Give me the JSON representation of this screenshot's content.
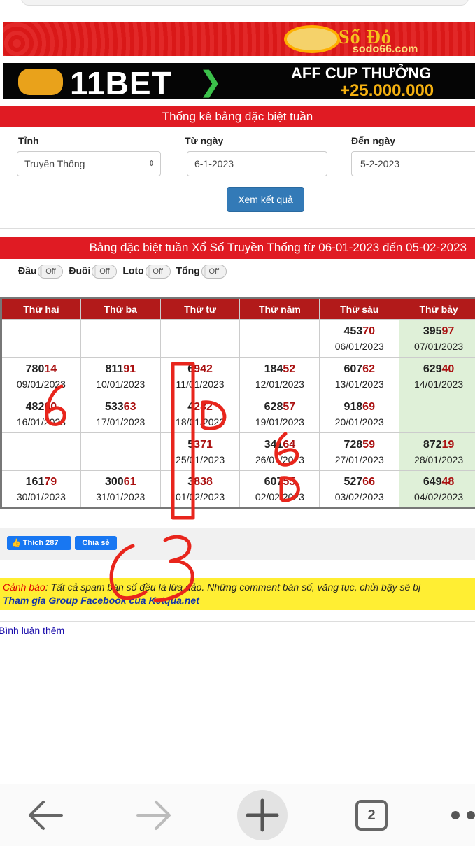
{
  "banners": {
    "sodo_brand": "Số Đỏ",
    "sodo_domain": "sodo66.com",
    "bet_brand": "11BET",
    "bet_promo_line1": "AFF CUP THƯỞNG",
    "bet_promo_line2": "+25.000.000"
  },
  "filter": {
    "title": "Thống kê bảng đặc biệt tuần",
    "province_label": "Tỉnh",
    "province_value": "Truyền Thống",
    "from_label": "Từ ngày",
    "from_value": "6-1-2023",
    "to_label": "Đến ngày",
    "to_value": "5-2-2023",
    "submit_label": "Xem kết quả"
  },
  "result": {
    "title": "Bảng đặc biệt tuần Xổ Số Truyền Thống từ 06-01-2023 đến 05-02-2023",
    "toggles": [
      {
        "label": "Đầu",
        "state": "Off"
      },
      {
        "label": "Đuôi",
        "state": "Off"
      },
      {
        "label": "Loto",
        "state": "Off"
      },
      {
        "label": "Tổng",
        "state": "Off"
      }
    ],
    "columns": [
      "Thứ hai",
      "Thứ ba",
      "Thứ tư",
      "Thứ năm",
      "Thứ sáu",
      "Thứ bảy"
    ],
    "rows": [
      [
        null,
        null,
        null,
        null,
        {
          "head": "453",
          "tail": "70",
          "date": "06/01/2023"
        },
        {
          "head": "395",
          "tail": "97",
          "date": "07/01/2023"
        }
      ],
      [
        {
          "head": "780",
          "tail": "14",
          "date": "09/01/2023"
        },
        {
          "head": "811",
          "tail": "91",
          "date": "10/01/2023"
        },
        {
          "head": "6",
          "tail": "942",
          "date": "11/01/2023"
        },
        {
          "head": "184",
          "tail": "52",
          "date": "12/01/2023"
        },
        {
          "head": "607",
          "tail": "62",
          "date": "13/01/2023"
        },
        {
          "head": "629",
          "tail": "40",
          "date": "14/01/2023"
        }
      ],
      [
        {
          "head": "482",
          "tail": "60",
          "date": "16/01/2023"
        },
        {
          "head": "533",
          "tail": "63",
          "date": "17/01/2023"
        },
        {
          "head": "4",
          "tail": "282",
          "date": "18/01/2023"
        },
        {
          "head": "628",
          "tail": "57",
          "date": "19/01/2023"
        },
        {
          "head": "918",
          "tail": "69",
          "date": "20/01/2023"
        },
        null
      ],
      [
        null,
        null,
        {
          "head": "5",
          "tail": "371",
          "date": "25/01/2023"
        },
        {
          "head": "341",
          "tail": "64",
          "date": "26/01/2023"
        },
        {
          "head": "728",
          "tail": "59",
          "date": "27/01/2023"
        },
        {
          "head": "872",
          "tail": "19",
          "date": "28/01/2023"
        }
      ],
      [
        {
          "head": "161",
          "tail": "79",
          "date": "30/01/2023"
        },
        {
          "head": "300",
          "tail": "61",
          "date": "31/01/2023"
        },
        {
          "head": "3",
          "tail": "838",
          "date": "01/02/2023"
        },
        {
          "head": "607",
          "tail": "55",
          "date": "02/02/2023"
        },
        {
          "head": "527",
          "tail": "66",
          "date": "03/02/2023"
        },
        {
          "head": "649",
          "tail": "48",
          "date": "04/02/2023"
        }
      ]
    ]
  },
  "social": {
    "like_label": "Thích 287",
    "share_label": "Chia sẻ"
  },
  "warning": {
    "prefix": "Cảnh báo",
    "text": ": Tất cả spam bán số đều là lừa đảo. Những comment bán số, văng tục, chửi bậy sẽ bị",
    "group_link": "Tham gia Group Facebook của Ketqua.net"
  },
  "more_comments": "Bình luận thêm",
  "browser": {
    "tab_count": "2"
  },
  "colors": {
    "red_bar": "#e01b23",
    "header_red": "#b21a1a",
    "saturday_green": "#dff0d8",
    "ink": "#e8251c",
    "primary_button": "#337ab7"
  }
}
